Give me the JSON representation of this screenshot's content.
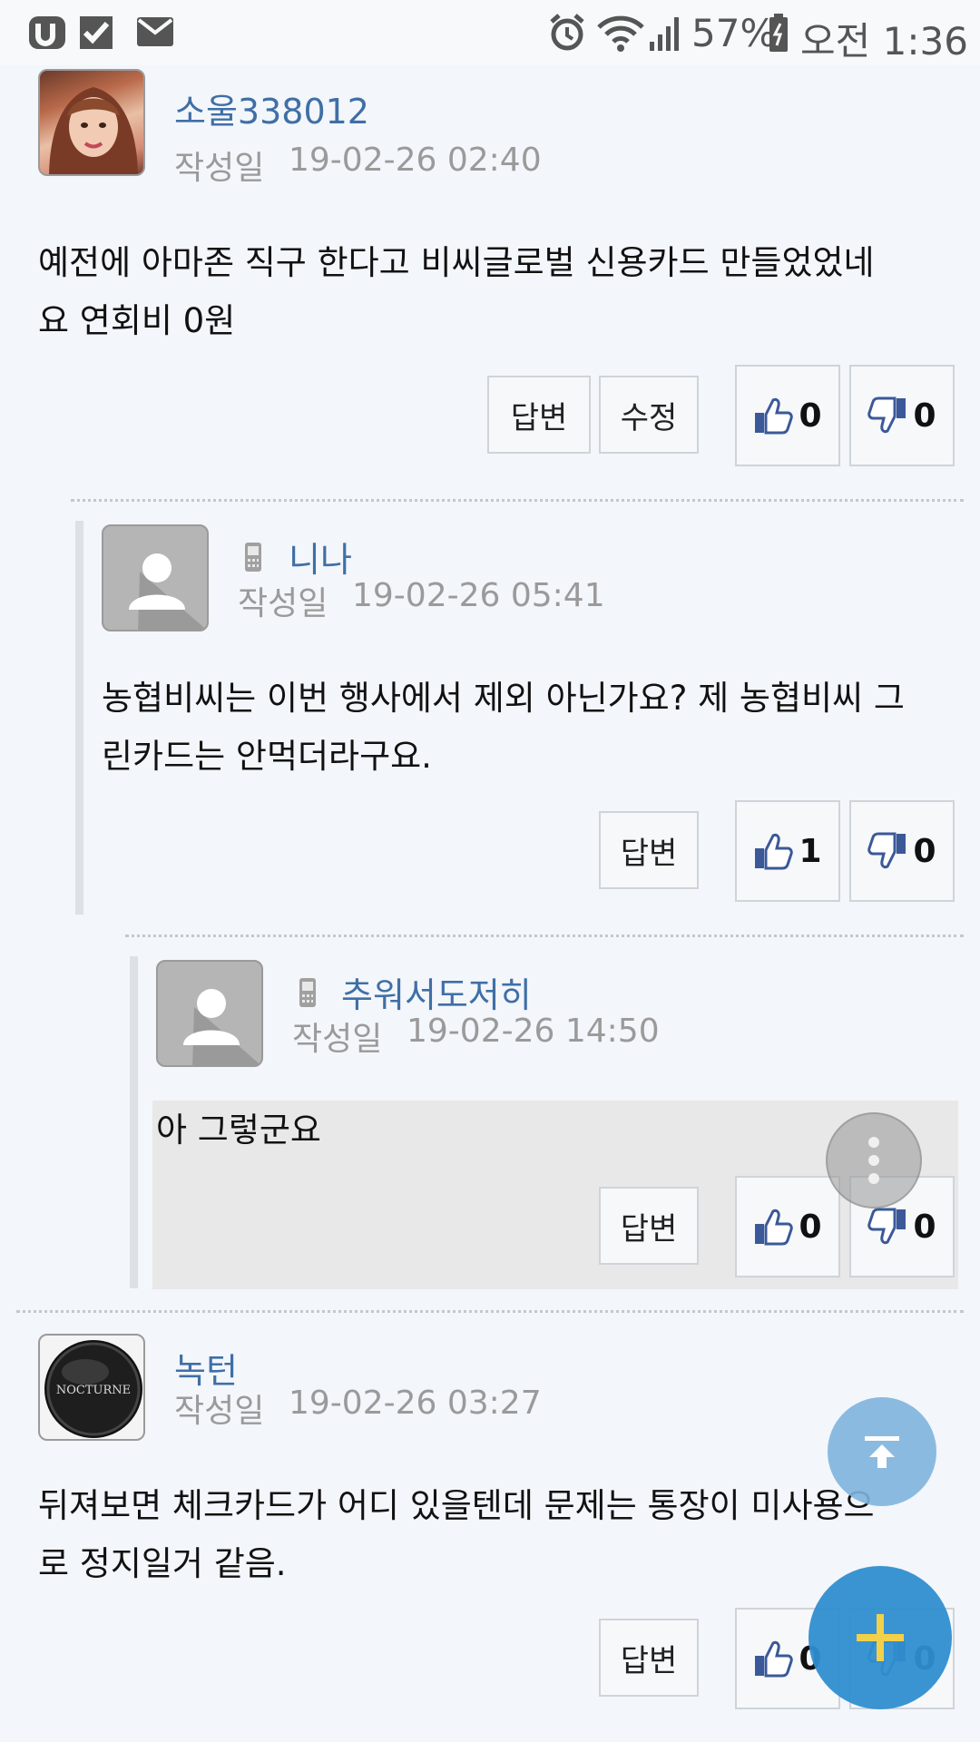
{
  "status_bar": {
    "battery": "57%",
    "time": "오전 1:36"
  },
  "comments": [
    {
      "nickname": "소울338012",
      "date_label": "작성일",
      "date": "19-02-26 02:40",
      "body_lines": [
        "예전에 아마존 직구 한다고 비씨글로벌 신용카드 만들었었네",
        "요 연회비 0원"
      ],
      "reply_label": "답변",
      "edit_label": "수정",
      "likes": "0",
      "dislikes": "0"
    },
    {
      "nickname": "니나",
      "date_label": "작성일",
      "date": "19-02-26 05:41",
      "body_lines": [
        "농협비씨는 이번 행사에서 제외 아닌가요? 제 농협비씨 그",
        "린카드는 안먹더라구요."
      ],
      "reply_label": "답변",
      "likes": "1",
      "dislikes": "0"
    },
    {
      "nickname": "추워서도저히",
      "date_label": "작성일",
      "date": "19-02-26 14:50",
      "body_lines": [
        "아 그렇군요"
      ],
      "reply_label": "답변",
      "likes": "0",
      "dislikes": "0"
    },
    {
      "nickname": "녹턴",
      "avatar_text": "NOCTURNE",
      "date_label": "작성일",
      "date": "19-02-26 03:27",
      "body_lines": [
        "뒤져보면 체크카드가 어디 있을텐데 문제는 통장이 미사용으",
        "로 정지일거 같음."
      ],
      "reply_label": "답변",
      "likes": "0",
      "dislikes": "0"
    }
  ],
  "colors": {
    "nickname": "#3f6fa6",
    "meta": "#9a9a9a",
    "fab_add": "#2f8ed0",
    "fab_top": "#7fb4de",
    "highlight_bg": "#e8e8e8"
  },
  "icons": {
    "like": "thumbs-up-icon",
    "dislike": "thumbs-down-icon",
    "mobile": "mobile-phone-icon",
    "more": "more-vertical-icon",
    "scroll_top": "scroll-top-icon",
    "add": "plus-icon"
  }
}
